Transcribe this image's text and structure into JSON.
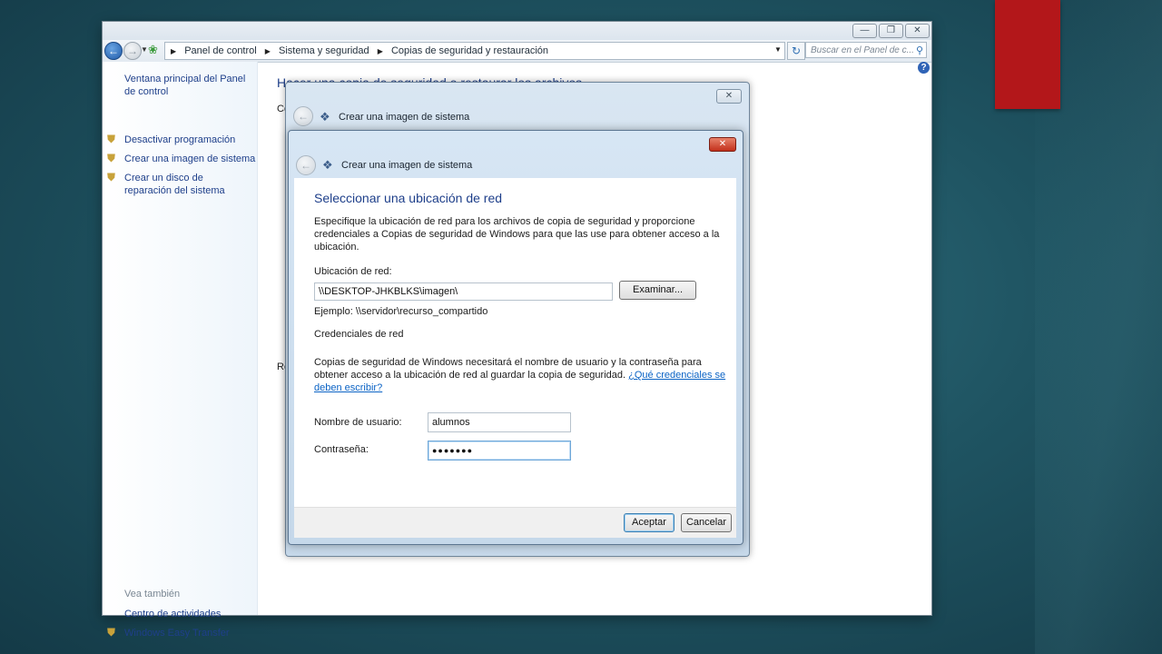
{
  "breadcrumb": {
    "items": [
      "Panel de control",
      "Sistema y seguridad",
      "Copias de seguridad y restauración"
    ]
  },
  "search": {
    "placeholder": "Buscar en el Panel de c..."
  },
  "sidebar": {
    "home_link": "Ventana principal del Panel de control",
    "tasks": [
      "Desactivar programación",
      "Crear una imagen de sistema",
      "Crear un disco de reparación del sistema"
    ],
    "see_also_title": "Vea también",
    "see_also": [
      "Centro de actividades",
      "Windows Easy Transfer"
    ]
  },
  "main": {
    "title": "Hacer una copia de seguridad o restaurar los archivos",
    "frag_1": "Co",
    "frag_2": "Re"
  },
  "dialog_outer": {
    "title": "Crear una imagen de sistema"
  },
  "dialog": {
    "title": "Crear una imagen de sistema",
    "heading": "Seleccionar una ubicación de red",
    "intro": "Especifique la ubicación de red para los archivos de copia de seguridad y proporcione credenciales a Copias de seguridad de Windows para que las use para obtener acceso a la ubicación.",
    "location_label": "Ubicación de red:",
    "location_value": "\\\\DESKTOP-JHKBLKS\\imagen\\",
    "browse_button": "Examinar...",
    "example": "Ejemplo: \\\\servidor\\recurso_compartido",
    "credentials_title": "Credenciales de red",
    "credentials_text": "Copias de seguridad de Windows necesitará el nombre de usuario y la contraseña para obtener acceso a la ubicación de red al guardar la copia de seguridad.",
    "credentials_link": "¿Qué credenciales se deben escribir?",
    "username_label": "Nombre de usuario:",
    "username_value": "alumnos",
    "password_label": "Contraseña:",
    "password_mask": "●●●●●●●",
    "ok_button": "Aceptar",
    "cancel_button": "Cancelar"
  },
  "colors": {
    "accent_red": "#b3171a",
    "link_blue": "#1e3f8a",
    "hyperlink": "#0b63c5"
  },
  "icons": [
    "back-arrow-icon",
    "forward-arrow-icon",
    "control-panel-icon",
    "refresh-icon",
    "search-icon",
    "help-icon",
    "shield-icon",
    "system-image-icon",
    "close-icon",
    "minimize-icon",
    "restore-icon"
  ]
}
